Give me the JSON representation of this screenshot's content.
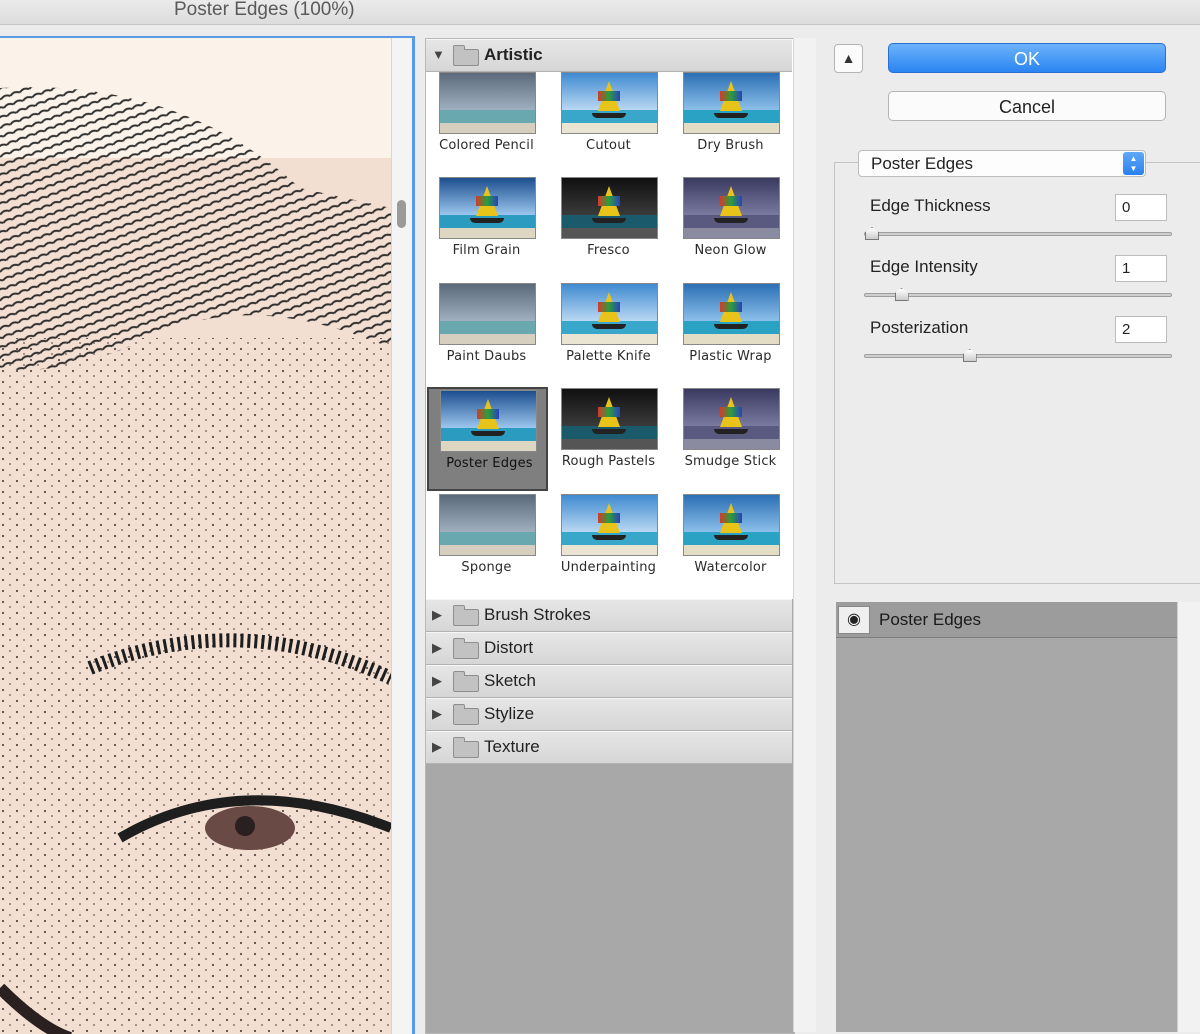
{
  "window": {
    "title": "Poster Edges (100%)"
  },
  "gallery": {
    "open_category": {
      "name": "Artistic",
      "filters": [
        "Colored Pencil",
        "Cutout",
        "Dry Brush",
        "Film Grain",
        "Fresco",
        "Neon Glow",
        "Paint Daubs",
        "Palette Knife",
        "Plastic Wrap",
        "Poster Edges",
        "Rough Pastels",
        "Smudge Stick",
        "Sponge",
        "Underpainting",
        "Watercolor"
      ],
      "selected": "Poster Edges"
    },
    "collapsed_categories": [
      "Brush Strokes",
      "Distort",
      "Sketch",
      "Stylize",
      "Texture"
    ]
  },
  "buttons": {
    "ok": "OK",
    "cancel": "Cancel"
  },
  "filter_select": {
    "value": "Poster Edges"
  },
  "params": [
    {
      "label": "Edge Thickness",
      "value": "0",
      "level": 0.0
    },
    {
      "label": "Edge Intensity",
      "value": "1",
      "level": 0.1
    },
    {
      "label": "Posterization",
      "value": "2",
      "level": 0.33
    }
  ],
  "layers": [
    {
      "name": "Poster Edges",
      "visible": true
    }
  ],
  "icons": {
    "expand": "triangle-down-icon",
    "collapse": "triangle-right-icon",
    "folder": "folder-icon",
    "eye": "eye-icon",
    "collapse_panel": "chevron-up-icon",
    "select_arrows": "up-down-arrows-icon"
  },
  "colors": {
    "accent": "#2a84f2",
    "selection_border": "#5b9ae6",
    "list_background": "#a8a8a8"
  }
}
